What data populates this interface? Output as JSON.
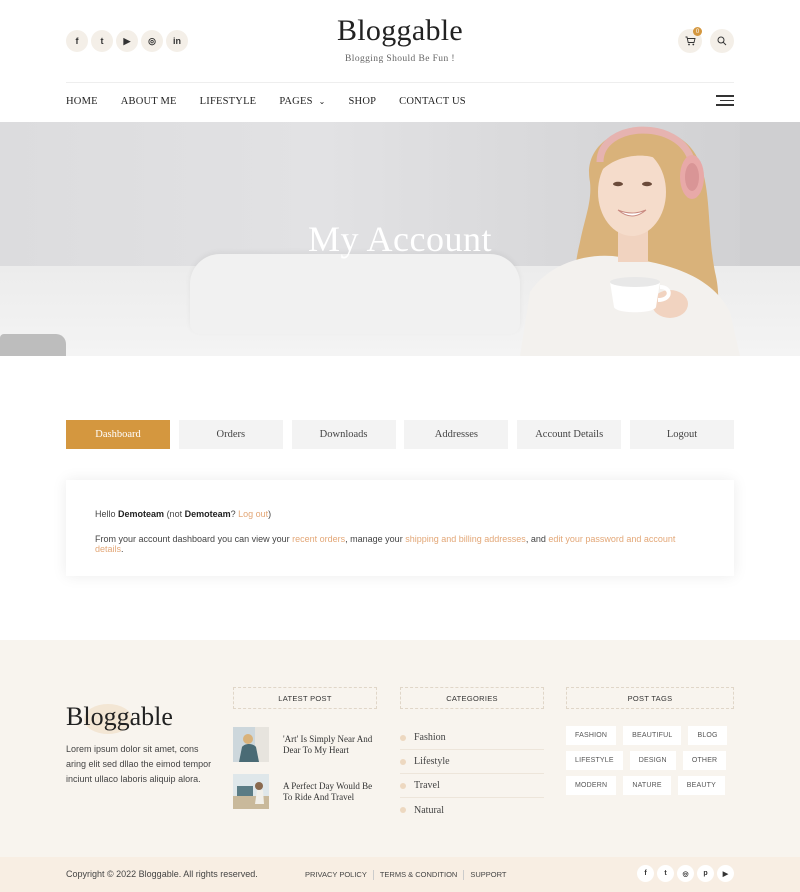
{
  "header": {
    "social": [
      {
        "icon": "facebook-icon",
        "glyph": "f"
      },
      {
        "icon": "twitter-icon",
        "glyph": "t"
      },
      {
        "icon": "youtube-icon",
        "glyph": "▶"
      },
      {
        "icon": "instagram-icon",
        "glyph": "◎"
      },
      {
        "icon": "linkedin-icon",
        "glyph": "in"
      }
    ],
    "logo": "Bloggable",
    "tagline": "Blogging Should Be Fun !",
    "cart_count": "0",
    "nav": [
      "HOME",
      "ABOUT ME",
      "LIFESTYLE",
      "PAGES",
      "SHOP",
      "CONTACT US"
    ]
  },
  "hero": {
    "title": "My Account"
  },
  "tabs": [
    "Dashboard",
    "Orders",
    "Downloads",
    "Addresses",
    "Account Details",
    "Logout"
  ],
  "account": {
    "hello": "Hello",
    "username": "Demoteam",
    "not": "(not",
    "username2": "Demoteam",
    "question": "?",
    "logout_link": "Log out",
    "close_paren": ")",
    "intro": "From your account dashboard you can view your",
    "recent_orders": "recent orders",
    "manage": ", manage your",
    "addresses_link": "shipping and billing addresses",
    "and": ", and",
    "password_link": "edit your password and account details",
    "period": "."
  },
  "footer": {
    "logo": "Bloggable",
    "description": "Lorem ipsum dolor sit amet, cons aring elit sed dllao the eimod tempor inciunt ullaco laboris aliquip alora.",
    "latest_post_title": "LATEST POST",
    "posts": [
      "'Art' Is Simply Near And Dear To My Heart",
      "A Perfect Day Would Be To Ride And Travel"
    ],
    "categories_title": "CATEGORIES",
    "categories": [
      "Fashion",
      "Lifestyle",
      "Travel",
      "Natural"
    ],
    "tags_title": "POST TAGS",
    "tags": [
      "FASHION",
      "BEAUTIFUL",
      "BLOG",
      "LIFESTYLE",
      "DESIGN",
      "OTHER",
      "MODERN",
      "NATURE",
      "BEAUTY"
    ],
    "copyright": "Copyright © 2022 Bloggable. All rights reserved.",
    "links": [
      "PRIVACY POLICY",
      "TERMS & CONDITION",
      "SUPPORT"
    ],
    "social": [
      {
        "icon": "facebook-icon",
        "glyph": "f"
      },
      {
        "icon": "twitter-icon",
        "glyph": "t"
      },
      {
        "icon": "instagram-icon",
        "glyph": "◎"
      },
      {
        "icon": "pinterest-icon",
        "glyph": "p"
      },
      {
        "icon": "youtube-icon",
        "glyph": "▶"
      }
    ]
  },
  "colors": {
    "accent": "#d4973f",
    "link": "#e3a777",
    "footer_bg": "#f8f4ee"
  }
}
